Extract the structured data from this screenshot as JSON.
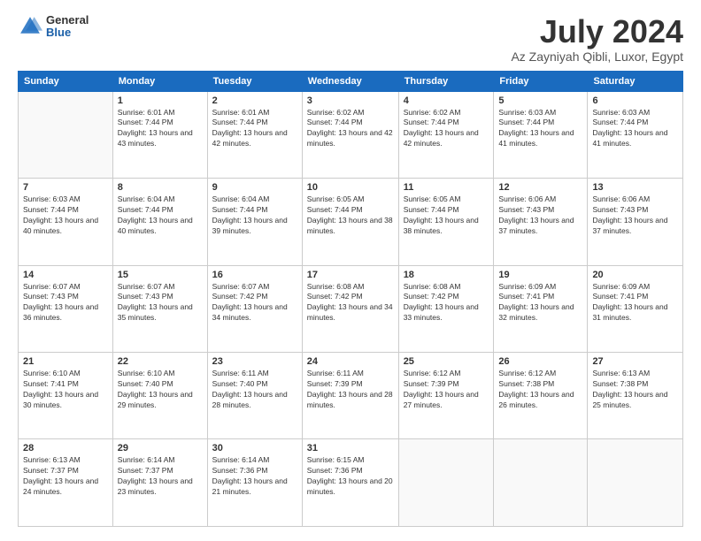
{
  "logo": {
    "general": "General",
    "blue": "Blue"
  },
  "header": {
    "month": "July 2024",
    "location": "Az Zayniyah Qibli, Luxor, Egypt"
  },
  "days_of_week": [
    "Sunday",
    "Monday",
    "Tuesday",
    "Wednesday",
    "Thursday",
    "Friday",
    "Saturday"
  ],
  "weeks": [
    [
      {
        "day": "",
        "sunrise": "",
        "sunset": "",
        "daylight": ""
      },
      {
        "day": "1",
        "sunrise": "6:01 AM",
        "sunset": "7:44 PM",
        "daylight": "13 hours and 43 minutes."
      },
      {
        "day": "2",
        "sunrise": "6:01 AM",
        "sunset": "7:44 PM",
        "daylight": "13 hours and 42 minutes."
      },
      {
        "day": "3",
        "sunrise": "6:02 AM",
        "sunset": "7:44 PM",
        "daylight": "13 hours and 42 minutes."
      },
      {
        "day": "4",
        "sunrise": "6:02 AM",
        "sunset": "7:44 PM",
        "daylight": "13 hours and 42 minutes."
      },
      {
        "day": "5",
        "sunrise": "6:03 AM",
        "sunset": "7:44 PM",
        "daylight": "13 hours and 41 minutes."
      },
      {
        "day": "6",
        "sunrise": "6:03 AM",
        "sunset": "7:44 PM",
        "daylight": "13 hours and 41 minutes."
      }
    ],
    [
      {
        "day": "7",
        "sunrise": "6:03 AM",
        "sunset": "7:44 PM",
        "daylight": "13 hours and 40 minutes."
      },
      {
        "day": "8",
        "sunrise": "6:04 AM",
        "sunset": "7:44 PM",
        "daylight": "13 hours and 40 minutes."
      },
      {
        "day": "9",
        "sunrise": "6:04 AM",
        "sunset": "7:44 PM",
        "daylight": "13 hours and 39 minutes."
      },
      {
        "day": "10",
        "sunrise": "6:05 AM",
        "sunset": "7:44 PM",
        "daylight": "13 hours and 38 minutes."
      },
      {
        "day": "11",
        "sunrise": "6:05 AM",
        "sunset": "7:44 PM",
        "daylight": "13 hours and 38 minutes."
      },
      {
        "day": "12",
        "sunrise": "6:06 AM",
        "sunset": "7:43 PM",
        "daylight": "13 hours and 37 minutes."
      },
      {
        "day": "13",
        "sunrise": "6:06 AM",
        "sunset": "7:43 PM",
        "daylight": "13 hours and 37 minutes."
      }
    ],
    [
      {
        "day": "14",
        "sunrise": "6:07 AM",
        "sunset": "7:43 PM",
        "daylight": "13 hours and 36 minutes."
      },
      {
        "day": "15",
        "sunrise": "6:07 AM",
        "sunset": "7:43 PM",
        "daylight": "13 hours and 35 minutes."
      },
      {
        "day": "16",
        "sunrise": "6:07 AM",
        "sunset": "7:42 PM",
        "daylight": "13 hours and 34 minutes."
      },
      {
        "day": "17",
        "sunrise": "6:08 AM",
        "sunset": "7:42 PM",
        "daylight": "13 hours and 34 minutes."
      },
      {
        "day": "18",
        "sunrise": "6:08 AM",
        "sunset": "7:42 PM",
        "daylight": "13 hours and 33 minutes."
      },
      {
        "day": "19",
        "sunrise": "6:09 AM",
        "sunset": "7:41 PM",
        "daylight": "13 hours and 32 minutes."
      },
      {
        "day": "20",
        "sunrise": "6:09 AM",
        "sunset": "7:41 PM",
        "daylight": "13 hours and 31 minutes."
      }
    ],
    [
      {
        "day": "21",
        "sunrise": "6:10 AM",
        "sunset": "7:41 PM",
        "daylight": "13 hours and 30 minutes."
      },
      {
        "day": "22",
        "sunrise": "6:10 AM",
        "sunset": "7:40 PM",
        "daylight": "13 hours and 29 minutes."
      },
      {
        "day": "23",
        "sunrise": "6:11 AM",
        "sunset": "7:40 PM",
        "daylight": "13 hours and 28 minutes."
      },
      {
        "day": "24",
        "sunrise": "6:11 AM",
        "sunset": "7:39 PM",
        "daylight": "13 hours and 28 minutes."
      },
      {
        "day": "25",
        "sunrise": "6:12 AM",
        "sunset": "7:39 PM",
        "daylight": "13 hours and 27 minutes."
      },
      {
        "day": "26",
        "sunrise": "6:12 AM",
        "sunset": "7:38 PM",
        "daylight": "13 hours and 26 minutes."
      },
      {
        "day": "27",
        "sunrise": "6:13 AM",
        "sunset": "7:38 PM",
        "daylight": "13 hours and 25 minutes."
      }
    ],
    [
      {
        "day": "28",
        "sunrise": "6:13 AM",
        "sunset": "7:37 PM",
        "daylight": "13 hours and 24 minutes."
      },
      {
        "day": "29",
        "sunrise": "6:14 AM",
        "sunset": "7:37 PM",
        "daylight": "13 hours and 23 minutes."
      },
      {
        "day": "30",
        "sunrise": "6:14 AM",
        "sunset": "7:36 PM",
        "daylight": "13 hours and 21 minutes."
      },
      {
        "day": "31",
        "sunrise": "6:15 AM",
        "sunset": "7:36 PM",
        "daylight": "13 hours and 20 minutes."
      },
      {
        "day": "",
        "sunrise": "",
        "sunset": "",
        "daylight": ""
      },
      {
        "day": "",
        "sunrise": "",
        "sunset": "",
        "daylight": ""
      },
      {
        "day": "",
        "sunrise": "",
        "sunset": "",
        "daylight": ""
      }
    ]
  ]
}
